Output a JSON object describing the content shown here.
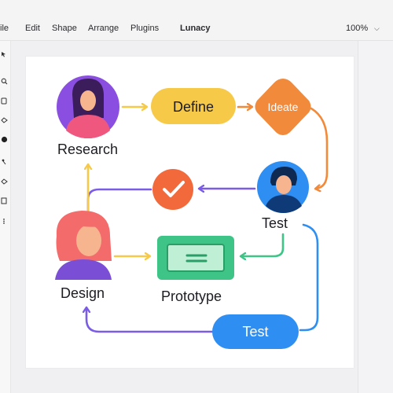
{
  "menubar": {
    "items": [
      "ile",
      "Edit",
      "Shape",
      "Arrange",
      "Plugins"
    ],
    "app_title": "Lunacy",
    "zoom": "100%"
  },
  "toolbar": {
    "icons": [
      "cursor-icon",
      "search-icon",
      "frame-icon",
      "pen-icon",
      "circle-fill-icon",
      "node-icon",
      "pen-tool-icon",
      "rectangle-icon",
      "more-icon"
    ]
  },
  "diagram": {
    "research_label": "Research",
    "define_label": "Define",
    "ideate_label": "Ideate",
    "test_label_top": "Test",
    "design_label": "Design",
    "prototype_label": "Prototype",
    "test_label_bottom": "Test"
  },
  "colors": {
    "purple": "#8a4fe0",
    "yellow": "#f7c948",
    "orange": "#f28a3c",
    "blue": "#2f8ef2",
    "green": "#3ec486",
    "coral": "#f46b6b",
    "violet_line": "#7a5ce6"
  }
}
